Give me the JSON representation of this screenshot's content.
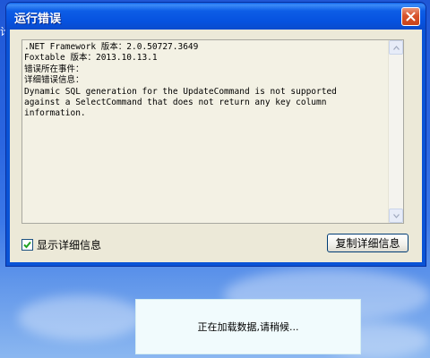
{
  "window": {
    "title": "运行错误",
    "details_lines": [
      ".NET Framework 版本：2.0.50727.3649",
      "Foxtable 版本：2013.10.13.1",
      "错误所在事件：",
      "详细错误信息：",
      "Dynamic SQL generation for the UpdateCommand is not supported",
      "against a SelectCommand that does not return any key column",
      "information."
    ],
    "show_details_label": "显示详细信息",
    "show_details_checked": true,
    "copy_button_label": "复制详细信息"
  },
  "desktop": {
    "edge_text": "计"
  },
  "loading": {
    "text": "正在加载数据,请稍候..."
  },
  "colors": {
    "title_bar": "#0a53d6",
    "close_button": "#d8532c",
    "dialog_background": "#ece9d8",
    "desktop": "#2b66e0"
  }
}
